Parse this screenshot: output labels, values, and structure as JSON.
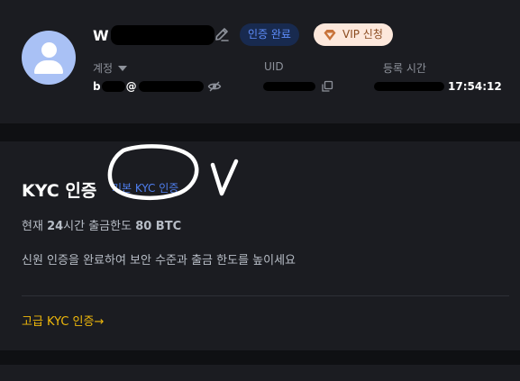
{
  "profile": {
    "username_visible": "W",
    "verified_badge": "인증 완료",
    "vip_badge": "VIP 신청",
    "account_label": "계정",
    "account_value_prefix": "b",
    "account_value_at": "@",
    "uid_label": "UID",
    "registration_label": "등록 시간",
    "registration_time": "17:54:12"
  },
  "kyc": {
    "title": "KYC 인증",
    "basic_level": "기본 KYC 인증",
    "limit_prefix": "현재 ",
    "limit_hours": "24",
    "limit_mid": "시간 출금한도 ",
    "limit_amount": "80 BTC",
    "description": "신원 인증을 완료하여 보안 수준과 출금 한도를 높이세요",
    "advanced_link": "고급 KYC 인증→"
  },
  "colors": {
    "background": "#0f1013",
    "card": "#1b1c21",
    "accent_blue": "#5e8dfb",
    "accent_gold": "#f0b90b",
    "avatar": "#a9c1f5"
  },
  "icons": {
    "edit": "pencil-icon",
    "vip": "diamond-icon",
    "hide": "eye-off-icon",
    "copy": "copy-icon"
  }
}
